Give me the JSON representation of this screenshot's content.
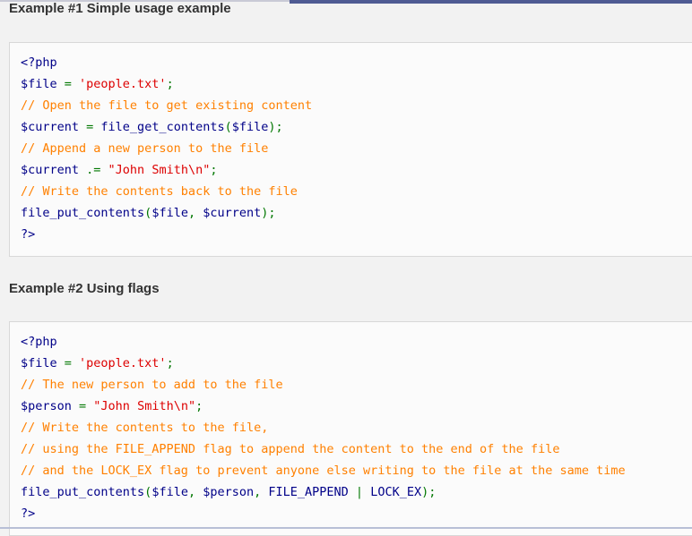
{
  "example1": {
    "title": "Example #1 Simple usage example",
    "code": [
      [
        {
          "t": "<?php",
          "c": "kw"
        }
      ],
      [
        {
          "t": "$file",
          "c": "var"
        },
        {
          "t": " = ",
          "c": "op"
        },
        {
          "t": "'people.txt'",
          "c": "str"
        },
        {
          "t": ";",
          "c": "op"
        }
      ],
      [
        {
          "t": "// Open the file to get existing content",
          "c": "cm"
        }
      ],
      [
        {
          "t": "$current",
          "c": "var"
        },
        {
          "t": " = ",
          "c": "op"
        },
        {
          "t": "file_get_contents",
          "c": "fn"
        },
        {
          "t": "(",
          "c": "op"
        },
        {
          "t": "$file",
          "c": "var"
        },
        {
          "t": ");",
          "c": "op"
        }
      ],
      [
        {
          "t": "// Append a new person to the file",
          "c": "cm"
        }
      ],
      [
        {
          "t": "$current",
          "c": "var"
        },
        {
          "t": " .= ",
          "c": "op"
        },
        {
          "t": "\"John Smith\\n\"",
          "c": "str"
        },
        {
          "t": ";",
          "c": "op"
        }
      ],
      [
        {
          "t": "// Write the contents back to the file",
          "c": "cm"
        }
      ],
      [
        {
          "t": "file_put_contents",
          "c": "fn"
        },
        {
          "t": "(",
          "c": "op"
        },
        {
          "t": "$file",
          "c": "var"
        },
        {
          "t": ", ",
          "c": "op"
        },
        {
          "t": "$current",
          "c": "var"
        },
        {
          "t": ");",
          "c": "op"
        }
      ],
      [
        {
          "t": "?>",
          "c": "kw"
        }
      ]
    ]
  },
  "example2": {
    "title": "Example #2 Using flags",
    "code": [
      [
        {
          "t": "<?php",
          "c": "kw"
        }
      ],
      [
        {
          "t": "$file",
          "c": "var"
        },
        {
          "t": " = ",
          "c": "op"
        },
        {
          "t": "'people.txt'",
          "c": "str"
        },
        {
          "t": ";",
          "c": "op"
        }
      ],
      [
        {
          "t": "// The new person to add to the file",
          "c": "cm"
        }
      ],
      [
        {
          "t": "$person",
          "c": "var"
        },
        {
          "t": " = ",
          "c": "op"
        },
        {
          "t": "\"John Smith\\n\"",
          "c": "str"
        },
        {
          "t": ";",
          "c": "op"
        }
      ],
      [
        {
          "t": "// Write the contents to the file,",
          "c": "cm"
        }
      ],
      [
        {
          "t": "// using the FILE_APPEND flag to append the content to the end of the file",
          "c": "cm"
        }
      ],
      [
        {
          "t": "// and the LOCK_EX flag to prevent anyone else writing to the file at the same time",
          "c": "cm"
        }
      ],
      [
        {
          "t": "file_put_contents",
          "c": "fn"
        },
        {
          "t": "(",
          "c": "op"
        },
        {
          "t": "$file",
          "c": "var"
        },
        {
          "t": ", ",
          "c": "op"
        },
        {
          "t": "$person",
          "c": "var"
        },
        {
          "t": ", ",
          "c": "op"
        },
        {
          "t": "FILE_APPEND",
          "c": "pl"
        },
        {
          "t": " | ",
          "c": "op"
        },
        {
          "t": "LOCK_EX",
          "c": "pl"
        },
        {
          "t": ");",
          "c": "op"
        }
      ],
      [
        {
          "t": "?>",
          "c": "kw"
        }
      ]
    ]
  }
}
